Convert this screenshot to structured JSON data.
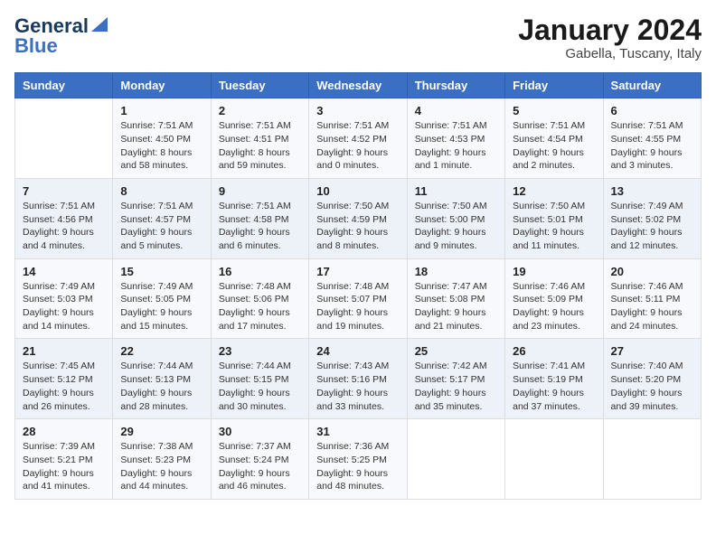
{
  "header": {
    "logo_line1": "General",
    "logo_line2": "Blue",
    "month": "January 2024",
    "location": "Gabella, Tuscany, Italy"
  },
  "weekdays": [
    "Sunday",
    "Monday",
    "Tuesday",
    "Wednesday",
    "Thursday",
    "Friday",
    "Saturday"
  ],
  "weeks": [
    [
      {
        "day": "",
        "detail": ""
      },
      {
        "day": "1",
        "detail": "Sunrise: 7:51 AM\nSunset: 4:50 PM\nDaylight: 8 hours\nand 58 minutes."
      },
      {
        "day": "2",
        "detail": "Sunrise: 7:51 AM\nSunset: 4:51 PM\nDaylight: 8 hours\nand 59 minutes."
      },
      {
        "day": "3",
        "detail": "Sunrise: 7:51 AM\nSunset: 4:52 PM\nDaylight: 9 hours\nand 0 minutes."
      },
      {
        "day": "4",
        "detail": "Sunrise: 7:51 AM\nSunset: 4:53 PM\nDaylight: 9 hours\nand 1 minute."
      },
      {
        "day": "5",
        "detail": "Sunrise: 7:51 AM\nSunset: 4:54 PM\nDaylight: 9 hours\nand 2 minutes."
      },
      {
        "day": "6",
        "detail": "Sunrise: 7:51 AM\nSunset: 4:55 PM\nDaylight: 9 hours\nand 3 minutes."
      }
    ],
    [
      {
        "day": "7",
        "detail": "Sunrise: 7:51 AM\nSunset: 4:56 PM\nDaylight: 9 hours\nand 4 minutes."
      },
      {
        "day": "8",
        "detail": "Sunrise: 7:51 AM\nSunset: 4:57 PM\nDaylight: 9 hours\nand 5 minutes."
      },
      {
        "day": "9",
        "detail": "Sunrise: 7:51 AM\nSunset: 4:58 PM\nDaylight: 9 hours\nand 6 minutes."
      },
      {
        "day": "10",
        "detail": "Sunrise: 7:50 AM\nSunset: 4:59 PM\nDaylight: 9 hours\nand 8 minutes."
      },
      {
        "day": "11",
        "detail": "Sunrise: 7:50 AM\nSunset: 5:00 PM\nDaylight: 9 hours\nand 9 minutes."
      },
      {
        "day": "12",
        "detail": "Sunrise: 7:50 AM\nSunset: 5:01 PM\nDaylight: 9 hours\nand 11 minutes."
      },
      {
        "day": "13",
        "detail": "Sunrise: 7:49 AM\nSunset: 5:02 PM\nDaylight: 9 hours\nand 12 minutes."
      }
    ],
    [
      {
        "day": "14",
        "detail": "Sunrise: 7:49 AM\nSunset: 5:03 PM\nDaylight: 9 hours\nand 14 minutes."
      },
      {
        "day": "15",
        "detail": "Sunrise: 7:49 AM\nSunset: 5:05 PM\nDaylight: 9 hours\nand 15 minutes."
      },
      {
        "day": "16",
        "detail": "Sunrise: 7:48 AM\nSunset: 5:06 PM\nDaylight: 9 hours\nand 17 minutes."
      },
      {
        "day": "17",
        "detail": "Sunrise: 7:48 AM\nSunset: 5:07 PM\nDaylight: 9 hours\nand 19 minutes."
      },
      {
        "day": "18",
        "detail": "Sunrise: 7:47 AM\nSunset: 5:08 PM\nDaylight: 9 hours\nand 21 minutes."
      },
      {
        "day": "19",
        "detail": "Sunrise: 7:46 AM\nSunset: 5:09 PM\nDaylight: 9 hours\nand 23 minutes."
      },
      {
        "day": "20",
        "detail": "Sunrise: 7:46 AM\nSunset: 5:11 PM\nDaylight: 9 hours\nand 24 minutes."
      }
    ],
    [
      {
        "day": "21",
        "detail": "Sunrise: 7:45 AM\nSunset: 5:12 PM\nDaylight: 9 hours\nand 26 minutes."
      },
      {
        "day": "22",
        "detail": "Sunrise: 7:44 AM\nSunset: 5:13 PM\nDaylight: 9 hours\nand 28 minutes."
      },
      {
        "day": "23",
        "detail": "Sunrise: 7:44 AM\nSunset: 5:15 PM\nDaylight: 9 hours\nand 30 minutes."
      },
      {
        "day": "24",
        "detail": "Sunrise: 7:43 AM\nSunset: 5:16 PM\nDaylight: 9 hours\nand 33 minutes."
      },
      {
        "day": "25",
        "detail": "Sunrise: 7:42 AM\nSunset: 5:17 PM\nDaylight: 9 hours\nand 35 minutes."
      },
      {
        "day": "26",
        "detail": "Sunrise: 7:41 AM\nSunset: 5:19 PM\nDaylight: 9 hours\nand 37 minutes."
      },
      {
        "day": "27",
        "detail": "Sunrise: 7:40 AM\nSunset: 5:20 PM\nDaylight: 9 hours\nand 39 minutes."
      }
    ],
    [
      {
        "day": "28",
        "detail": "Sunrise: 7:39 AM\nSunset: 5:21 PM\nDaylight: 9 hours\nand 41 minutes."
      },
      {
        "day": "29",
        "detail": "Sunrise: 7:38 AM\nSunset: 5:23 PM\nDaylight: 9 hours\nand 44 minutes."
      },
      {
        "day": "30",
        "detail": "Sunrise: 7:37 AM\nSunset: 5:24 PM\nDaylight: 9 hours\nand 46 minutes."
      },
      {
        "day": "31",
        "detail": "Sunrise: 7:36 AM\nSunset: 5:25 PM\nDaylight: 9 hours\nand 48 minutes."
      },
      {
        "day": "",
        "detail": ""
      },
      {
        "day": "",
        "detail": ""
      },
      {
        "day": "",
        "detail": ""
      }
    ]
  ]
}
